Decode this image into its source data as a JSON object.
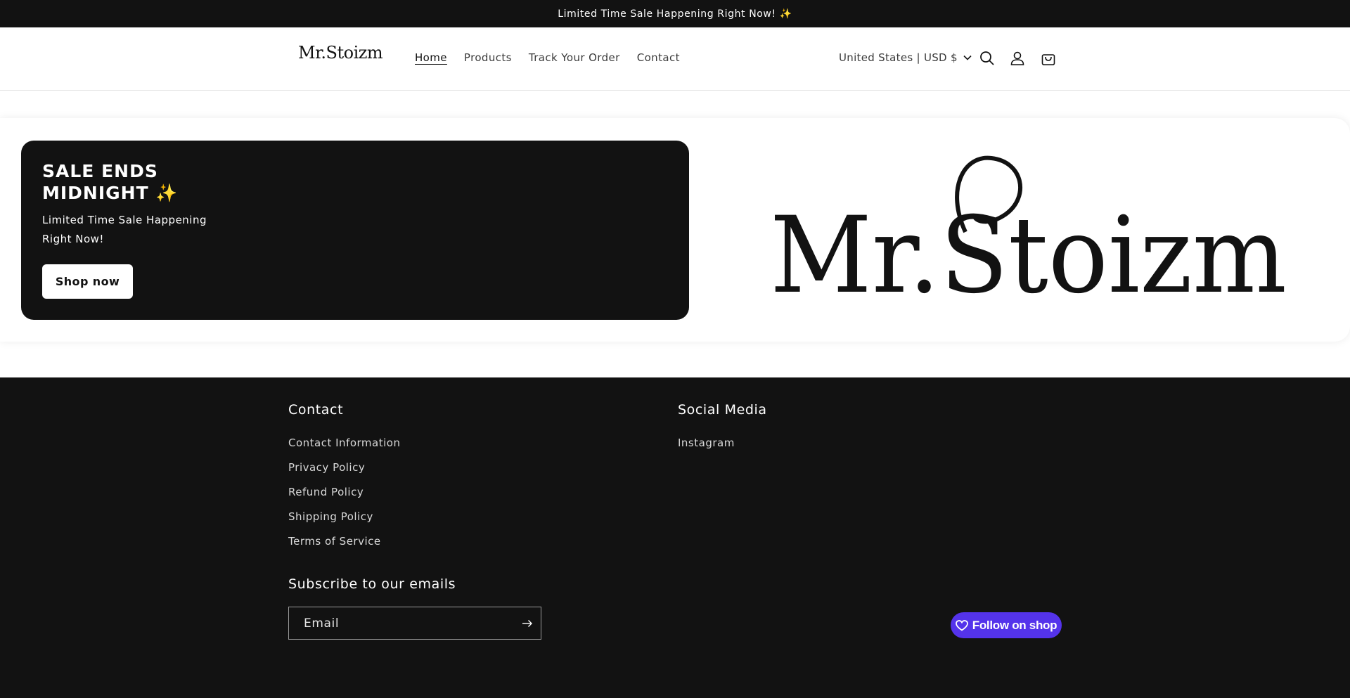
{
  "announcement": {
    "text": "Limited Time Sale Happening Right Now! ✨"
  },
  "header": {
    "logo": "Mr.Stoizm",
    "nav": [
      {
        "label": "Home",
        "active": true
      },
      {
        "label": "Products",
        "active": false
      },
      {
        "label": "Track Your Order",
        "active": false
      },
      {
        "label": "Contact",
        "active": false
      }
    ],
    "locale": "United States | USD $",
    "icons": [
      "search-icon",
      "account-icon",
      "cart-icon",
      "chevron-down-icon"
    ]
  },
  "banner": {
    "title": "SALE ENDS MIDNIGHT ✨",
    "subtitle": "Limited Time Sale Happening Right Now!",
    "button": "Shop now",
    "image_logo": "Mr.Stoizm"
  },
  "footer": {
    "contact": {
      "heading": "Contact",
      "links": [
        "Contact Information",
        "Privacy Policy",
        "Refund Policy",
        "Shipping Policy",
        "Terms of Service"
      ]
    },
    "social": {
      "heading": "Social Media",
      "links": [
        "Instagram"
      ]
    },
    "subscribe": {
      "heading": "Subscribe to our emails",
      "email_placeholder": "Email"
    },
    "follow_button": "Follow on shop"
  },
  "colors": {
    "dark": "#121212",
    "white": "#ffffff",
    "shop_purple": "#5433eb"
  }
}
